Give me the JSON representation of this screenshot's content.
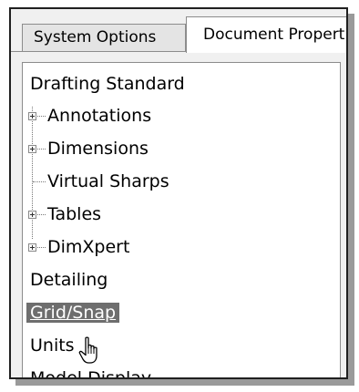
{
  "tabs": [
    {
      "label": "System Options",
      "active": false
    },
    {
      "label": "Document Properties",
      "active": true
    }
  ],
  "tree": {
    "items": [
      {
        "label": "Drafting Standard",
        "level": 0,
        "expandable": false
      },
      {
        "label": "Annotations",
        "level": 1,
        "expandable": true
      },
      {
        "label": "Dimensions",
        "level": 1,
        "expandable": true
      },
      {
        "label": "Virtual Sharps",
        "level": 1,
        "expandable": false
      },
      {
        "label": "Tables",
        "level": 1,
        "expandable": true
      },
      {
        "label": "DimXpert",
        "level": 1,
        "expandable": true
      },
      {
        "label": "Detailing",
        "level": 0,
        "expandable": false
      },
      {
        "label": "Grid/Snap",
        "level": 0,
        "expandable": false,
        "selected": true
      },
      {
        "label": "Units",
        "level": 0,
        "expandable": false
      },
      {
        "label": "Model Display",
        "level": 0,
        "expandable": false
      }
    ]
  },
  "cursor": {
    "icon": "hand-pointer-icon"
  },
  "colors": {
    "selected_bg": "#6e6e6e",
    "selected_text": "#ffffff"
  }
}
